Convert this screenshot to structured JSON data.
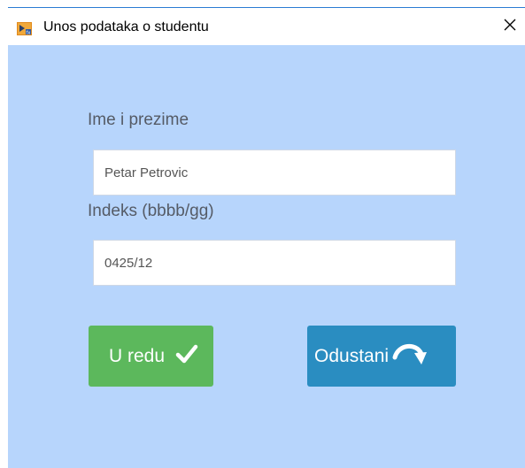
{
  "window": {
    "title": "Unos podataka o studentu",
    "icon": "app-icon",
    "close_icon": "close-icon"
  },
  "form": {
    "name_label": "Ime i prezime",
    "name_value": "Petar Petrovic",
    "index_label": "Indeks (bbbb/gg)",
    "index_value": "0425/12"
  },
  "buttons": {
    "ok_label": "U redu",
    "ok_icon": "checkmark-icon",
    "cancel_label": "Odustani",
    "cancel_icon": "curved-arrow-icon"
  },
  "colors": {
    "background": "#b7d5fc",
    "ok_button": "#5cb85c",
    "cancel_button": "#2a8dc1"
  }
}
